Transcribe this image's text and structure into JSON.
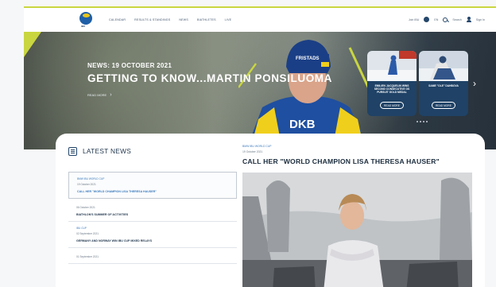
{
  "header": {
    "logo_text": "IBU",
    "nav": [
      "CALENDAR",
      "RESULTS & STANDINGS",
      "NEWS",
      "BIATHLETES",
      "LIVE"
    ],
    "right": {
      "item1": "Join IBU",
      "language": "EN",
      "search": "Search",
      "signin": "Sign In"
    }
  },
  "hero": {
    "date_line": "NEWS: 19 OCTOBER 2021",
    "title": "GETTING TO KNOW...MARTIN PONSILUOMA",
    "read_more": "READ MORE",
    "cards": [
      {
        "text": "EMILIEN JACQUELIN WINS SECOND CONSECUTIVE OS PURSUIT GOLD MEDAL",
        "button": "READ MORE"
      },
      {
        "text": "SAME \"OLE\" DAHBOVA",
        "button": "READ MORE"
      }
    ]
  },
  "latest_news": {
    "heading": "LATEST NEWS",
    "items": [
      {
        "category": "BMW IBU WORLD CUP",
        "date": "19 October 2021",
        "title": "CALL HER \"WORLD CHAMPION LISA THERESA HAUSER\"",
        "active": true
      },
      {
        "category": "",
        "date": "06 October 2021",
        "title": "BIATHLON'S SUMMER OF ACTIVITIES",
        "active": false
      },
      {
        "category": "IBU CUP",
        "date": "02 September 2021",
        "title": "GERMANY AND NORWAY WIN IBU CUP MIXED RELAYS",
        "active": false
      },
      {
        "category": "",
        "date": "01 September 2021",
        "title": "",
        "active": false
      }
    ]
  },
  "article": {
    "category": "BMW IBU WORLD CUP",
    "date": "19 October 2021",
    "title": "CALL HER \"WORLD CHAMPION LISA THERESA HAUSER\""
  },
  "colors": {
    "accent": "#c9d640",
    "navy": "#24466b",
    "link_blue": "#3c7bbd"
  }
}
